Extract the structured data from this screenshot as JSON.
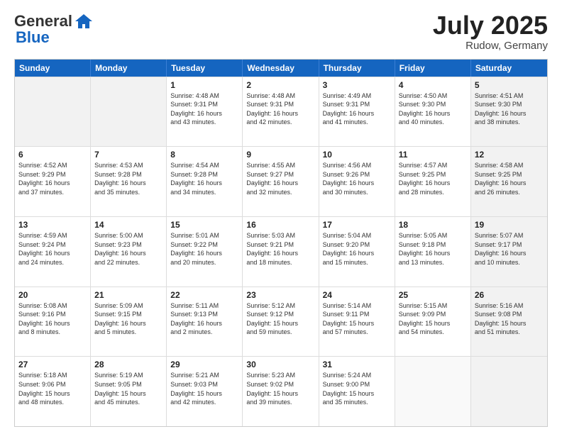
{
  "header": {
    "logo_general": "General",
    "logo_blue": "Blue",
    "month_year": "July 2025",
    "location": "Rudow, Germany"
  },
  "weekdays": [
    "Sunday",
    "Monday",
    "Tuesday",
    "Wednesday",
    "Thursday",
    "Friday",
    "Saturday"
  ],
  "rows": [
    [
      {
        "day": "",
        "info": "",
        "shaded": true
      },
      {
        "day": "",
        "info": "",
        "shaded": true
      },
      {
        "day": "1",
        "info": "Sunrise: 4:48 AM\nSunset: 9:31 PM\nDaylight: 16 hours\nand 43 minutes.",
        "shaded": false
      },
      {
        "day": "2",
        "info": "Sunrise: 4:48 AM\nSunset: 9:31 PM\nDaylight: 16 hours\nand 42 minutes.",
        "shaded": false
      },
      {
        "day": "3",
        "info": "Sunrise: 4:49 AM\nSunset: 9:31 PM\nDaylight: 16 hours\nand 41 minutes.",
        "shaded": false
      },
      {
        "day": "4",
        "info": "Sunrise: 4:50 AM\nSunset: 9:30 PM\nDaylight: 16 hours\nand 40 minutes.",
        "shaded": false
      },
      {
        "day": "5",
        "info": "Sunrise: 4:51 AM\nSunset: 9:30 PM\nDaylight: 16 hours\nand 38 minutes.",
        "shaded": true
      }
    ],
    [
      {
        "day": "6",
        "info": "Sunrise: 4:52 AM\nSunset: 9:29 PM\nDaylight: 16 hours\nand 37 minutes.",
        "shaded": false
      },
      {
        "day": "7",
        "info": "Sunrise: 4:53 AM\nSunset: 9:28 PM\nDaylight: 16 hours\nand 35 minutes.",
        "shaded": false
      },
      {
        "day": "8",
        "info": "Sunrise: 4:54 AM\nSunset: 9:28 PM\nDaylight: 16 hours\nand 34 minutes.",
        "shaded": false
      },
      {
        "day": "9",
        "info": "Sunrise: 4:55 AM\nSunset: 9:27 PM\nDaylight: 16 hours\nand 32 minutes.",
        "shaded": false
      },
      {
        "day": "10",
        "info": "Sunrise: 4:56 AM\nSunset: 9:26 PM\nDaylight: 16 hours\nand 30 minutes.",
        "shaded": false
      },
      {
        "day": "11",
        "info": "Sunrise: 4:57 AM\nSunset: 9:25 PM\nDaylight: 16 hours\nand 28 minutes.",
        "shaded": false
      },
      {
        "day": "12",
        "info": "Sunrise: 4:58 AM\nSunset: 9:25 PM\nDaylight: 16 hours\nand 26 minutes.",
        "shaded": true
      }
    ],
    [
      {
        "day": "13",
        "info": "Sunrise: 4:59 AM\nSunset: 9:24 PM\nDaylight: 16 hours\nand 24 minutes.",
        "shaded": false
      },
      {
        "day": "14",
        "info": "Sunrise: 5:00 AM\nSunset: 9:23 PM\nDaylight: 16 hours\nand 22 minutes.",
        "shaded": false
      },
      {
        "day": "15",
        "info": "Sunrise: 5:01 AM\nSunset: 9:22 PM\nDaylight: 16 hours\nand 20 minutes.",
        "shaded": false
      },
      {
        "day": "16",
        "info": "Sunrise: 5:03 AM\nSunset: 9:21 PM\nDaylight: 16 hours\nand 18 minutes.",
        "shaded": false
      },
      {
        "day": "17",
        "info": "Sunrise: 5:04 AM\nSunset: 9:20 PM\nDaylight: 16 hours\nand 15 minutes.",
        "shaded": false
      },
      {
        "day": "18",
        "info": "Sunrise: 5:05 AM\nSunset: 9:18 PM\nDaylight: 16 hours\nand 13 minutes.",
        "shaded": false
      },
      {
        "day": "19",
        "info": "Sunrise: 5:07 AM\nSunset: 9:17 PM\nDaylight: 16 hours\nand 10 minutes.",
        "shaded": true
      }
    ],
    [
      {
        "day": "20",
        "info": "Sunrise: 5:08 AM\nSunset: 9:16 PM\nDaylight: 16 hours\nand 8 minutes.",
        "shaded": false
      },
      {
        "day": "21",
        "info": "Sunrise: 5:09 AM\nSunset: 9:15 PM\nDaylight: 16 hours\nand 5 minutes.",
        "shaded": false
      },
      {
        "day": "22",
        "info": "Sunrise: 5:11 AM\nSunset: 9:13 PM\nDaylight: 16 hours\nand 2 minutes.",
        "shaded": false
      },
      {
        "day": "23",
        "info": "Sunrise: 5:12 AM\nSunset: 9:12 PM\nDaylight: 15 hours\nand 59 minutes.",
        "shaded": false
      },
      {
        "day": "24",
        "info": "Sunrise: 5:14 AM\nSunset: 9:11 PM\nDaylight: 15 hours\nand 57 minutes.",
        "shaded": false
      },
      {
        "day": "25",
        "info": "Sunrise: 5:15 AM\nSunset: 9:09 PM\nDaylight: 15 hours\nand 54 minutes.",
        "shaded": false
      },
      {
        "day": "26",
        "info": "Sunrise: 5:16 AM\nSunset: 9:08 PM\nDaylight: 15 hours\nand 51 minutes.",
        "shaded": true
      }
    ],
    [
      {
        "day": "27",
        "info": "Sunrise: 5:18 AM\nSunset: 9:06 PM\nDaylight: 15 hours\nand 48 minutes.",
        "shaded": false
      },
      {
        "day": "28",
        "info": "Sunrise: 5:19 AM\nSunset: 9:05 PM\nDaylight: 15 hours\nand 45 minutes.",
        "shaded": false
      },
      {
        "day": "29",
        "info": "Sunrise: 5:21 AM\nSunset: 9:03 PM\nDaylight: 15 hours\nand 42 minutes.",
        "shaded": false
      },
      {
        "day": "30",
        "info": "Sunrise: 5:23 AM\nSunset: 9:02 PM\nDaylight: 15 hours\nand 39 minutes.",
        "shaded": false
      },
      {
        "day": "31",
        "info": "Sunrise: 5:24 AM\nSunset: 9:00 PM\nDaylight: 15 hours\nand 35 minutes.",
        "shaded": false
      },
      {
        "day": "",
        "info": "",
        "shaded": false
      },
      {
        "day": "",
        "info": "",
        "shaded": true
      }
    ]
  ]
}
